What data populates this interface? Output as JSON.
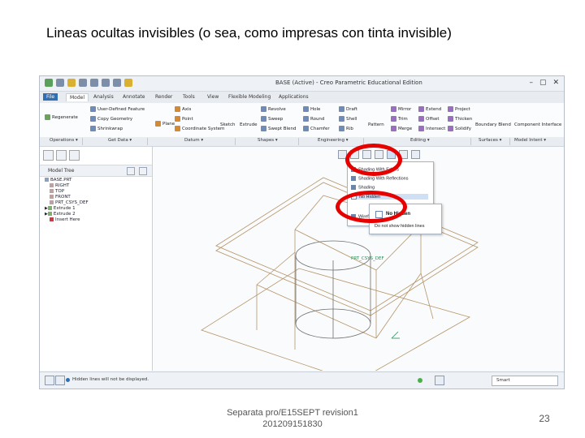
{
  "slide": {
    "title": "Lineas ocultas invisibles (o sea, como impresas con tinta invisible)",
    "footer_line1": "Separata pro/E15SEPT revision1",
    "footer_line2": "201209151830",
    "page_number": "23"
  },
  "app": {
    "window_title": "BASE (Active) - Creo Parametric Educational Edition",
    "window_controls": [
      "–",
      "▢",
      "✕"
    ],
    "tabs": [
      "File",
      "Model",
      "Analysis",
      "Annotate",
      "Render",
      "Tools",
      "View",
      "Flexible Modeling",
      "Applications"
    ],
    "ribbon": {
      "regenerate": "Regenerate",
      "user_defined_feature": "User-Defined Feature",
      "copy_geometry": "Copy Geometry",
      "shrinkwrap": "Shrinkwrap",
      "axis": "Axis",
      "point": "Point",
      "coordinate_system": "Coordinate System",
      "plane": "Plane",
      "sketch": "Sketch",
      "extrude": "Extrude",
      "revolve": "Revolve",
      "sweep": "Sweep",
      "swept_blend": "Swept Blend",
      "hole": "Hole",
      "round": "Round",
      "chamfer": "Chamfer",
      "draft": "Draft",
      "shell": "Shell",
      "rib": "Rib",
      "pattern": "Pattern",
      "mirror": "Mirror",
      "trim": "Trim",
      "merge": "Merge",
      "extend": "Extend",
      "offset": "Offset",
      "intersect": "Intersect",
      "project": "Project",
      "thicken": "Thicken",
      "solidify": "Solidify",
      "boundary_blend": "Boundary Blend",
      "component_interface": "Component Interface"
    },
    "groups": [
      "Operations ▾",
      "Get Data ▾",
      "Datum ▾",
      "Shapes ▾",
      "Engineering ▾",
      "Editing ▾",
      "Surfaces ▾",
      "Model Intent ▾"
    ],
    "model_tree": {
      "header": "Model Tree",
      "items": [
        "BASE.PRT",
        "RIGHT",
        "TOP",
        "FRONT",
        "PRT_CSYS_DEF",
        "Extrude 1",
        "Extrude 2",
        "Insert Here"
      ]
    },
    "display_menu": {
      "items": [
        "Shading With Edges",
        "Shading With Reflections",
        "Shading",
        "No Hidden",
        "Wireframe"
      ],
      "selected": "No Hidden"
    },
    "tooltip": {
      "title": "No Hidden",
      "description": "Do not show hidden lines"
    },
    "model_label": "PRT_CSYS_DEF",
    "status": {
      "message": "Hidden lines will not be displayed.",
      "filter": "Smart"
    }
  },
  "colors": {
    "highlight_circle": "#e60000",
    "model_edges": "#b5956a",
    "hidden_edges": "#6d6d6d"
  }
}
